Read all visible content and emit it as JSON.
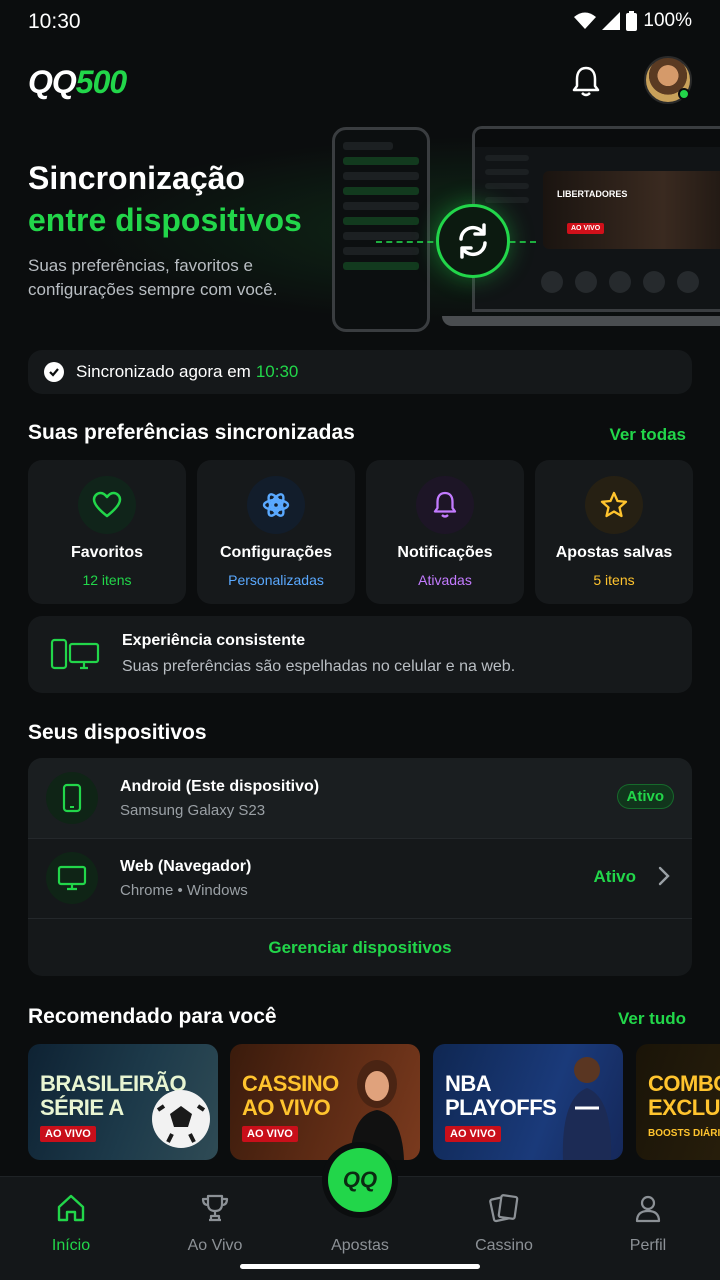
{
  "status_bar": {
    "time": "10:30",
    "battery": "100%"
  },
  "header": {
    "logo_qq": "QQ",
    "logo_num": "500"
  },
  "hero": {
    "title_line1": "Sincronização",
    "title_line2": "entre dispositivos",
    "subtitle": "Suas preferências, favoritos e configurações sempre com você.",
    "laptop_banner": "LIBERTADORES",
    "laptop_badge": "AO VIVO"
  },
  "sync_status": {
    "text": "Sincronizado agora em",
    "time": "10:30"
  },
  "preferences": {
    "title": "Suas preferências sincronizadas",
    "see_all": "Ver todas",
    "cards": [
      {
        "label": "Favoritos",
        "sub": "12 itens",
        "icon": "heart-icon",
        "color": "#22d64a",
        "bg": "#10241a"
      },
      {
        "label": "Configurações",
        "sub": "Personalizadas",
        "icon": "gear-icon",
        "color": "#5aa9ff",
        "bg": "#121d2b"
      },
      {
        "label": "Notificações",
        "sub": "Ativadas",
        "icon": "bell-icon",
        "color": "#c37bff",
        "bg": "#1d1526"
      },
      {
        "label": "Apostas salvas",
        "sub": "5 itens",
        "icon": "star-icon",
        "color": "#ffc42e",
        "bg": "#262013"
      }
    ]
  },
  "consistent": {
    "title": "Experiência consistente",
    "subtitle": "Suas preferências são espelhadas no celular e na web."
  },
  "devices": {
    "title": "Seus dispositivos",
    "items": [
      {
        "name": "Android (Este dispositivo)",
        "sub": "Samsung Galaxy S23",
        "state": "Ativo",
        "icon": "phone-icon"
      },
      {
        "name": "Web (Navegador)",
        "sub": "Chrome • Windows",
        "state": "Ativo",
        "icon": "monitor-icon"
      }
    ],
    "manage": "Gerenciar dispositivos"
  },
  "recommended": {
    "title": "Recomendado para você",
    "see_all": "Ver tudo",
    "items": [
      {
        "line1": "BRASILEIRÃO",
        "line2": "SÉRIE A",
        "tag": "AO VIVO"
      },
      {
        "line1": "CASSINO",
        "line2": "AO VIVO",
        "tag": "AO VIVO"
      },
      {
        "line1": "NBA",
        "line2": "PLAYOFFS",
        "tag": "AO VIVO"
      },
      {
        "line1": "COMBO",
        "line2": "EXCLUSI",
        "tag": "BOOSTS DIÁRIOS"
      }
    ]
  },
  "nav": {
    "items": [
      {
        "label": "Início",
        "active": true
      },
      {
        "label": "Ao Vivo"
      },
      {
        "label": "Apostas"
      },
      {
        "label": "Cassino"
      },
      {
        "label": "Perfil"
      }
    ],
    "fab_label": "QQ"
  },
  "colors": {
    "accent": "#22d64a",
    "background": "#0b0d0e",
    "card": "#16191b"
  }
}
